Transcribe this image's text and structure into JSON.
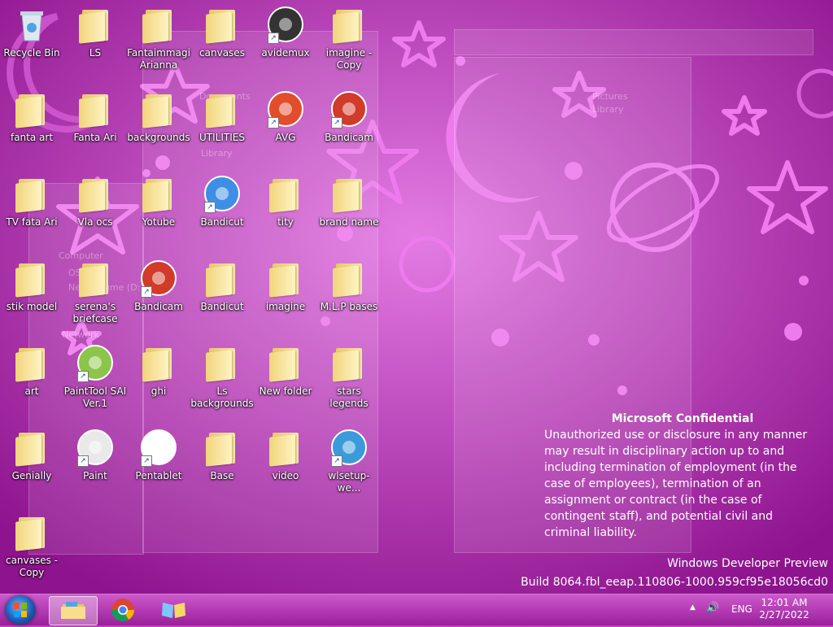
{
  "desktop": {
    "icons": [
      {
        "label": "Recycle Bin",
        "type": "recycle"
      },
      {
        "label": "LS",
        "type": "folder"
      },
      {
        "label": "Fantaimmagi Arianna",
        "type": "folder"
      },
      {
        "label": "canvases",
        "type": "folder"
      },
      {
        "label": "avidemux",
        "type": "app"
      },
      {
        "label": "imagine - Copy",
        "type": "folder"
      },
      {
        "label": "fanta art",
        "type": "folder"
      },
      {
        "label": "Fanta Ari",
        "type": "folder"
      },
      {
        "label": "backgrounds",
        "type": "folder"
      },
      {
        "label": "UTILITIES",
        "type": "folder"
      },
      {
        "label": "AVG",
        "type": "app"
      },
      {
        "label": "Bandicam",
        "type": "app"
      },
      {
        "label": "TV fata Ari",
        "type": "folder"
      },
      {
        "label": "Vla ocs",
        "type": "folder"
      },
      {
        "label": "Yotube",
        "type": "folder"
      },
      {
        "label": "Bandicut",
        "type": "app"
      },
      {
        "label": "tity",
        "type": "folder"
      },
      {
        "label": "brand name",
        "type": "folder"
      },
      {
        "label": "stik model",
        "type": "folder"
      },
      {
        "label": "serena's briefcase",
        "type": "folder"
      },
      {
        "label": "Bandicam",
        "type": "app"
      },
      {
        "label": "Bandicut",
        "type": "folder"
      },
      {
        "label": "imagine",
        "type": "folder"
      },
      {
        "label": "M.L.P bases",
        "type": "folder"
      },
      {
        "label": "art",
        "type": "folder"
      },
      {
        "label": "PaintTool SAI Ver.1",
        "type": "app"
      },
      {
        "label": "ghi",
        "type": "folder"
      },
      {
        "label": "Ls backgrounds",
        "type": "folder"
      },
      {
        "label": "New folder",
        "type": "folder"
      },
      {
        "label": "stars legends",
        "type": "folder"
      },
      {
        "label": "Genially",
        "type": "folder"
      },
      {
        "label": "Paint",
        "type": "app"
      },
      {
        "label": "Pentablet",
        "type": "app"
      },
      {
        "label": "Base",
        "type": "folder"
      },
      {
        "label": "video",
        "type": "folder"
      },
      {
        "label": "wlsetup-we...",
        "type": "app"
      },
      {
        "label": "canvases - Copy",
        "type": "folder"
      }
    ]
  },
  "ghost_window": {
    "documents": "Documents",
    "library": "Library",
    "pictures": "Pictures",
    "pictures_library": "Library",
    "computer": "Computer",
    "os": "OS (C:)",
    "new_volume": "New Volume (D:)",
    "network": "Network"
  },
  "watermark": {
    "title": "Microsoft Confidential",
    "body": "Unauthorized use or disclosure in any manner may result in disciplinary action up to and including termination of employment (in the case of employees), termination of an assignment or contract (in the case of contingent staff), and potential civil and criminal liability.",
    "product": "Windows Developer Preview",
    "build": "Build 8064.fbl_eeap.110806-1000.959cf95e18056cd0"
  },
  "taskbar": {
    "start_icon": "windows-start-icon",
    "pinned": [
      "file-explorer-icon",
      "chrome-icon",
      "windows-live-icon"
    ],
    "tray": {
      "show_hidden": "▲",
      "volume": "🔊",
      "language": "ENG",
      "time": "12:01 AM",
      "date": "2/27/2022"
    }
  },
  "colors": {
    "accent": "#c23fc0",
    "taskbar": "#b23ab2"
  }
}
